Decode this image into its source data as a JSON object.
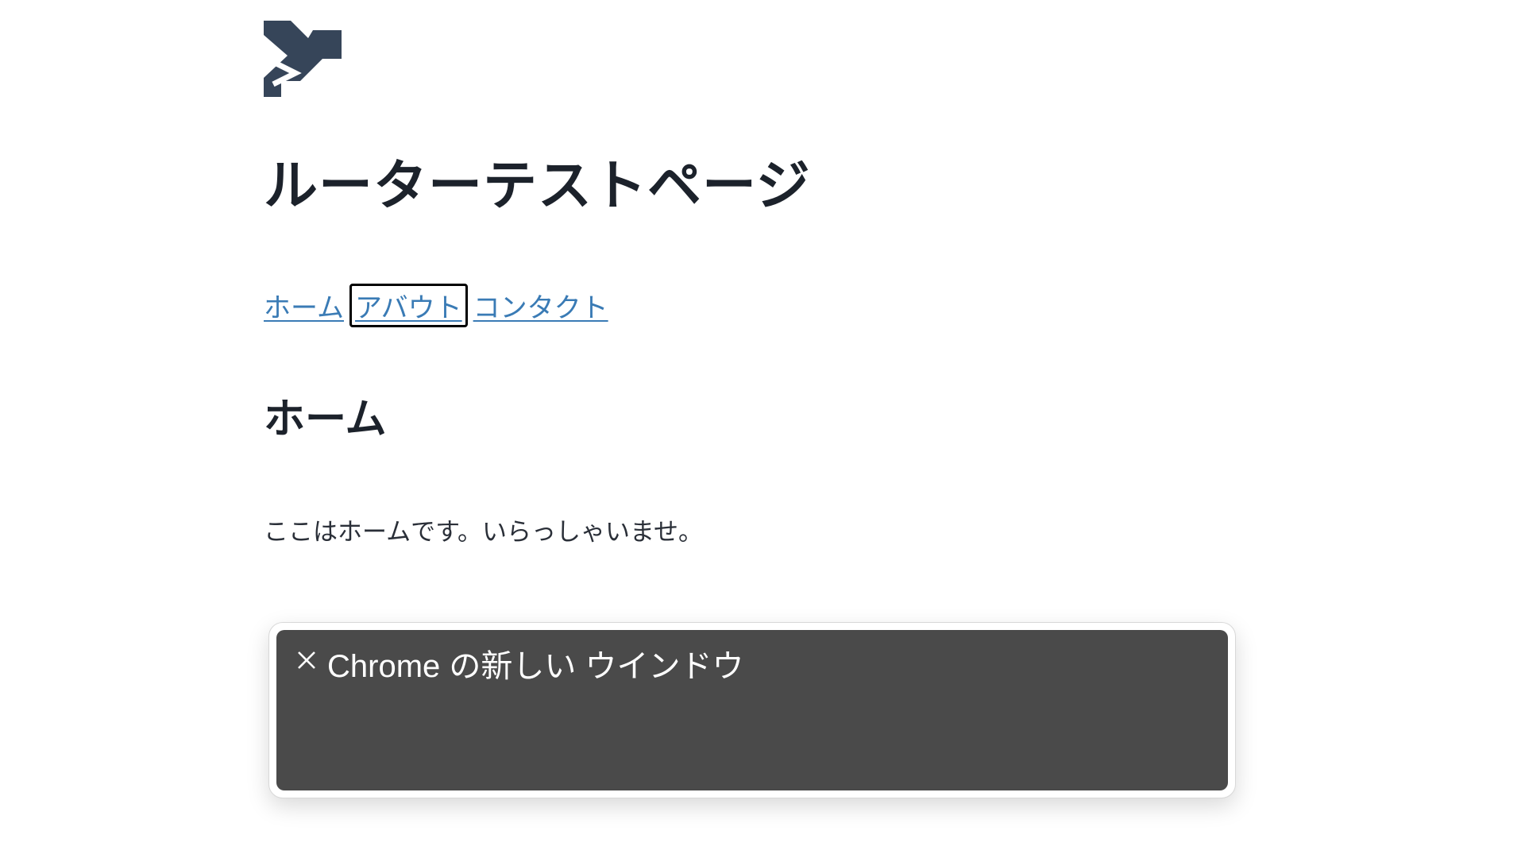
{
  "logo": {
    "icon": "y-logo-icon",
    "color": "#364559"
  },
  "page": {
    "title": "ルーターテストページ",
    "subtitle": "ホーム",
    "body": "ここはホームです。いらっしゃいませ。"
  },
  "nav": {
    "home": "ホーム",
    "about": "アバウト",
    "contact": "コンタクト",
    "focused": "about",
    "link_color": "#3a7bb5"
  },
  "notification": {
    "title": "Chrome の新しい ウインドウ",
    "close_icon": "close-icon",
    "background": "#4a4a4a"
  }
}
